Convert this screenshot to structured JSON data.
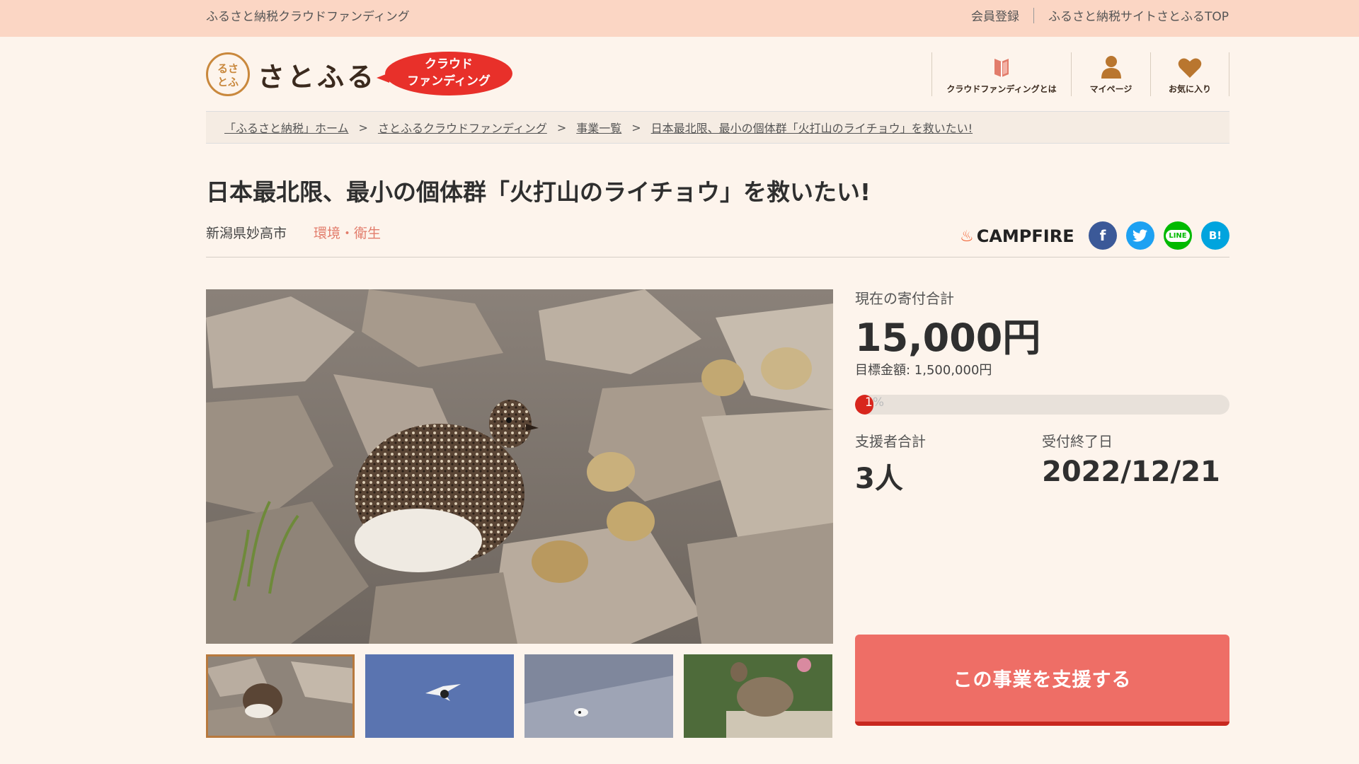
{
  "topbar": {
    "site_label": "ふるさと納税クラウドファンディング",
    "register": "会員登録",
    "top_link": "ふるさと納税サイトさとふるTOP"
  },
  "header": {
    "logo_text": "さとふる",
    "emblem_text": "るさとふ",
    "badge_line1": "クラウド",
    "badge_line2": "ファンディング",
    "nav": [
      {
        "label": "クラウドファンディングとは",
        "icon": "book-icon"
      },
      {
        "label": "マイページ",
        "icon": "user-icon"
      },
      {
        "label": "お気に入り",
        "icon": "heart-icon"
      }
    ]
  },
  "breadcrumb": [
    "「ふるさと納税」ホーム",
    "さとふるクラウドファンディング",
    "事業一覧",
    "日本最北限、最小の個体群「火打山のライチョウ」を救いたい!"
  ],
  "breadcrumb_separator": ">",
  "project": {
    "title": "日本最北限、最小の個体群「火打山のライチョウ」を救いたい!",
    "location": "新潟県妙高市",
    "category": "環境・衛生",
    "partner": "CAMPFIRE"
  },
  "share": {
    "facebook": "f",
    "twitter": "t",
    "line": "LINE",
    "hatena": "B!"
  },
  "stats": {
    "total_label": "現在の寄付合計",
    "total": "15,000円",
    "goal": "目標金額: 1,500,000円",
    "progress_percent": 1,
    "progress_text_main": "1",
    "progress_text_rest": "%",
    "supporters_label": "支援者合計",
    "supporters": "3人",
    "deadline_label": "受付終了日",
    "deadline": "2022/12/21"
  },
  "support_button": "この事業を支援する",
  "colors": {
    "accent": "#ee6e66",
    "progress": "#d8261d",
    "topbar": "#fbd6c4",
    "background": "#fdf4ec"
  }
}
